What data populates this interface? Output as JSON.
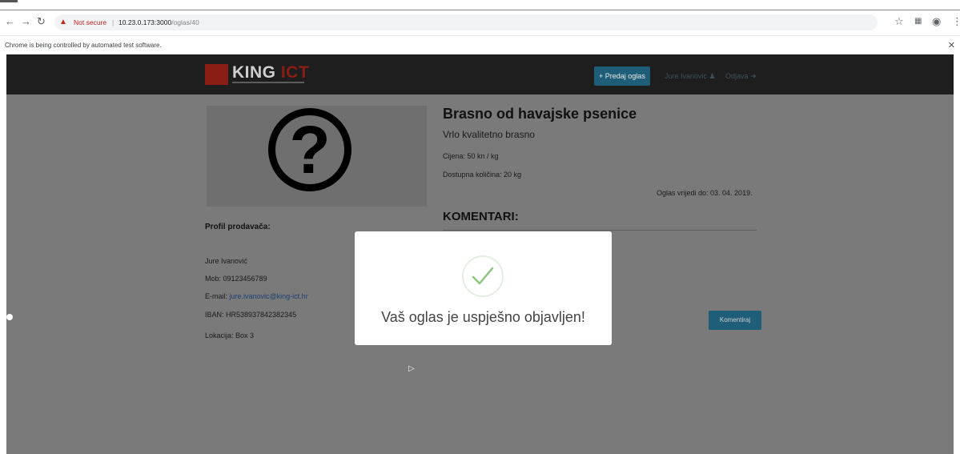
{
  "browser": {
    "not_secure": "Not secure",
    "separator": "|",
    "url_host": "10.23.0.173:3000",
    "url_path": "/oglas/40",
    "infobar_message": "Chrome is being controlled by automated test software."
  },
  "navbar": {
    "logo_king": "KING",
    "logo_ict": "ICT",
    "post_ad_button": "Predaj oglas",
    "user_name": "Jure Ivanović",
    "logout": "Odjava"
  },
  "product": {
    "title": "Brasno od havajske psenice",
    "description": "Vrlo kvalitetno brasno",
    "price": "Cijena: 50 kn / kg",
    "quantity": "Dostupna količina: 20 kg",
    "valid_until": "Oglas vrijedi do: 03. 04. 2019."
  },
  "comments": {
    "heading": "KOMENTARI:",
    "button": "Komentiraj"
  },
  "seller": {
    "heading": "Profil prodavača:",
    "name": "Jure Ivanović",
    "phone": "Mob: 09123456789",
    "email_label": "E-mail: ",
    "email": "jure.ivanovic@king-ict.hr",
    "iban": "IBAN: HR538937842382345",
    "location": "Lokacija: Box 3"
  },
  "modal": {
    "message": "Vaš oglas je uspješno objavljen!",
    "icon": "checkmark-icon",
    "icon_color": "#8cc47e"
  },
  "colors": {
    "overlay": "#7a7a7a",
    "navbar": "#1e1e1e",
    "primary_button": "#1f5e78",
    "brand_red": "#8a1d14"
  }
}
